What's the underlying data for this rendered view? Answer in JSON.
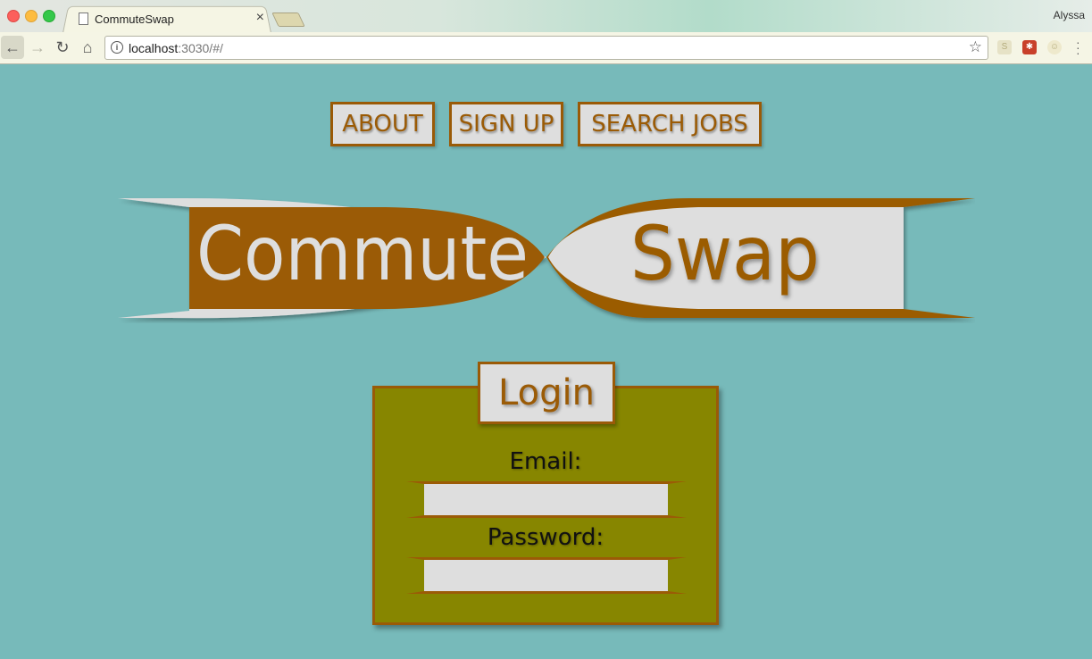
{
  "browser": {
    "tab_title": "CommuteSwap",
    "tab_close": "×",
    "url_host": "localhost",
    "url_rest": ":3030/#/",
    "profile_name": "Alyssa"
  },
  "nav": {
    "items": [
      {
        "label": "ABOUT"
      },
      {
        "label": "SIGN UP"
      },
      {
        "label": "SEARCH JOBS"
      }
    ]
  },
  "logo": {
    "left_word": "Commute",
    "right_word": "Swap"
  },
  "login": {
    "title": "Login",
    "email_label": "Email:",
    "email_value": "",
    "password_label": "Password:",
    "password_value": ""
  },
  "colors": {
    "background": "#77baba",
    "brown": "#9b5b06",
    "panel": "#878600",
    "light": "#dedede"
  }
}
